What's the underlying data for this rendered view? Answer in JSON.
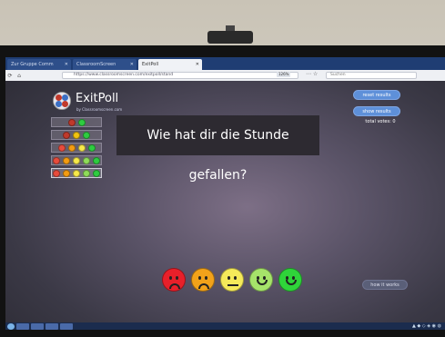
{
  "browser": {
    "tabs": [
      {
        "label": "Zur Gruppe Comm",
        "active": false
      },
      {
        "label": "ClassroomScreen",
        "active": false
      },
      {
        "label": "ExitPoll",
        "active": true
      }
    ],
    "url": "https://www.classroomscreen.com/exitpoll/stand",
    "zoom": "126%",
    "search_placeholder": "Suchen"
  },
  "app": {
    "name": "ExitPoll",
    "byline": "by Classroomscreen.com",
    "question": "Wie hat dir die Stunde gefallen?",
    "reset_label": "reset results",
    "show_label": "show results",
    "votes_text": "total votes: 0",
    "how_label": "how it works",
    "option_sets": [
      [
        "#c0392b",
        "#2ecc40"
      ],
      [
        "#c0392b",
        "#f1c40f",
        "#2ecc40"
      ],
      [
        "#e74c3c",
        "#f39c12",
        "#f7e94a",
        "#2ecc40"
      ],
      [
        "#e74c3c",
        "#f39c12",
        "#f7e94a",
        "#8fdc5a",
        "#2ecc40"
      ],
      [
        "#e74c3c",
        "#f39c12",
        "#f7e94a",
        "#8fdc5a",
        "#2ecc40"
      ]
    ],
    "selected_option": 4,
    "faces": [
      {
        "name": "very-unhappy",
        "color": "#e8202a",
        "mouth": "frown"
      },
      {
        "name": "unhappy",
        "color": "#f2a21a",
        "mouth": "frown"
      },
      {
        "name": "neutral",
        "color": "#f5ea5a",
        "mouth": "flat"
      },
      {
        "name": "happy",
        "color": "#a6e36a",
        "mouth": "smile"
      },
      {
        "name": "very-happy",
        "color": "#2fd43a",
        "mouth": "smile"
      }
    ]
  }
}
